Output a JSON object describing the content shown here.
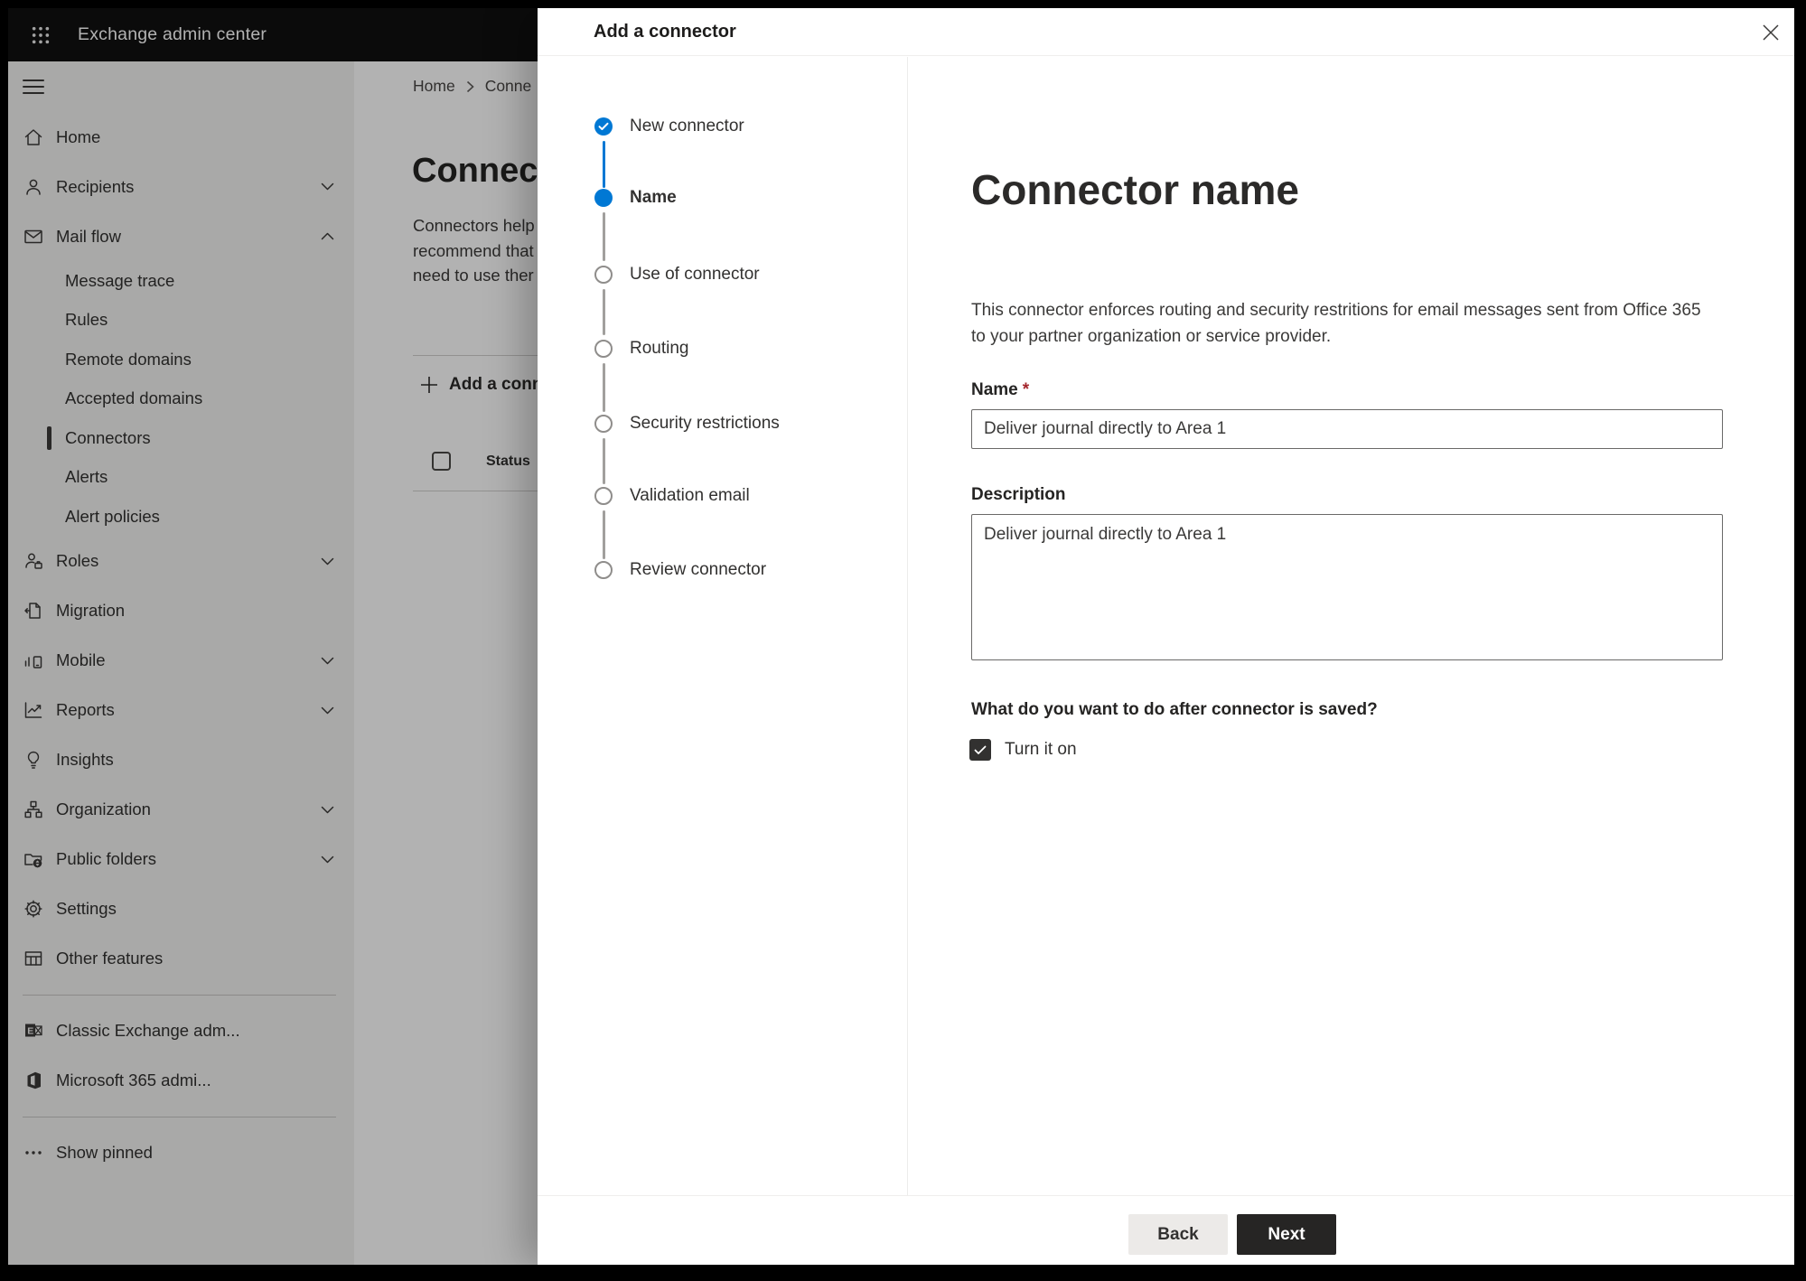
{
  "topbar": {
    "app_title": "Exchange admin center"
  },
  "sidebar": {
    "items": [
      {
        "label": "Home"
      },
      {
        "label": "Recipients"
      },
      {
        "label": "Mail flow"
      },
      {
        "label": "Message trace"
      },
      {
        "label": "Rules"
      },
      {
        "label": "Remote domains"
      },
      {
        "label": "Accepted domains"
      },
      {
        "label": "Connectors"
      },
      {
        "label": "Alerts"
      },
      {
        "label": "Alert policies"
      },
      {
        "label": "Roles"
      },
      {
        "label": "Migration"
      },
      {
        "label": "Mobile"
      },
      {
        "label": "Reports"
      },
      {
        "label": "Insights"
      },
      {
        "label": "Organization"
      },
      {
        "label": "Public folders"
      },
      {
        "label": "Settings"
      },
      {
        "label": "Other features"
      },
      {
        "label": "Classic Exchange adm..."
      },
      {
        "label": "Microsoft 365 admi..."
      },
      {
        "label": "Show pinned"
      }
    ]
  },
  "page": {
    "breadcrumb_home": "Home",
    "breadcrumb_current": "Conne",
    "heading": "Connec",
    "intro_line1": "Connectors help",
    "intro_line2": "recommend that",
    "intro_line3": "need to use ther",
    "add_button_label": "Add a conn",
    "table": {
      "status_header": "Status"
    }
  },
  "panel": {
    "title": "Add a connector",
    "steps": [
      {
        "label": "New connector",
        "state": "completed"
      },
      {
        "label": "Name",
        "state": "current"
      },
      {
        "label": "Use of connector",
        "state": "upcoming"
      },
      {
        "label": "Routing",
        "state": "upcoming"
      },
      {
        "label": "Security restrictions",
        "state": "upcoming"
      },
      {
        "label": "Validation email",
        "state": "upcoming"
      },
      {
        "label": "Review connector",
        "state": "upcoming"
      }
    ],
    "content": {
      "heading": "Connector name",
      "intro_line1": "This connector enforces routing and security restritions for email messages sent from Office 365",
      "intro_line2": "to your partner organization or service provider.",
      "name_label": "Name",
      "required_mark": "*",
      "name_value": "Deliver journal directly to Area 1",
      "description_label": "Description",
      "description_value": "Deliver journal directly to Area 1",
      "after_save_question": "What do you want to do after connector is saved?",
      "turn_on_label": "Turn it on",
      "turn_on_checked": true
    },
    "footer": {
      "back_label": "Back",
      "next_label": "Next"
    }
  },
  "colors": {
    "accent_blue": "#0078d4",
    "primary_button_bg": "#262524",
    "required_red": "#a4262c",
    "topbar_bg": "#101010",
    "sidebar_bg": "#f3f2f1"
  }
}
